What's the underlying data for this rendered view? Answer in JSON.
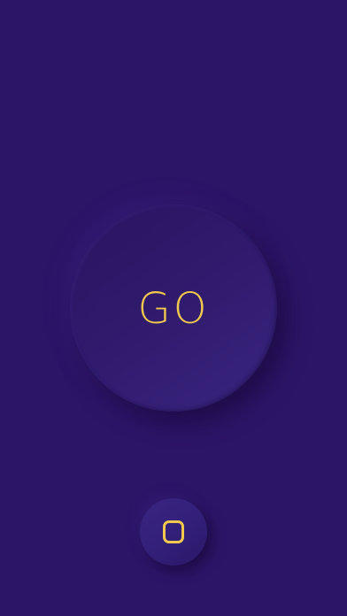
{
  "main": {
    "go_button_label": "GO",
    "stop_button_icon": "rounded-square-stop-icon"
  },
  "colors": {
    "background": "#2c1567",
    "accent": "#f2c94c"
  }
}
